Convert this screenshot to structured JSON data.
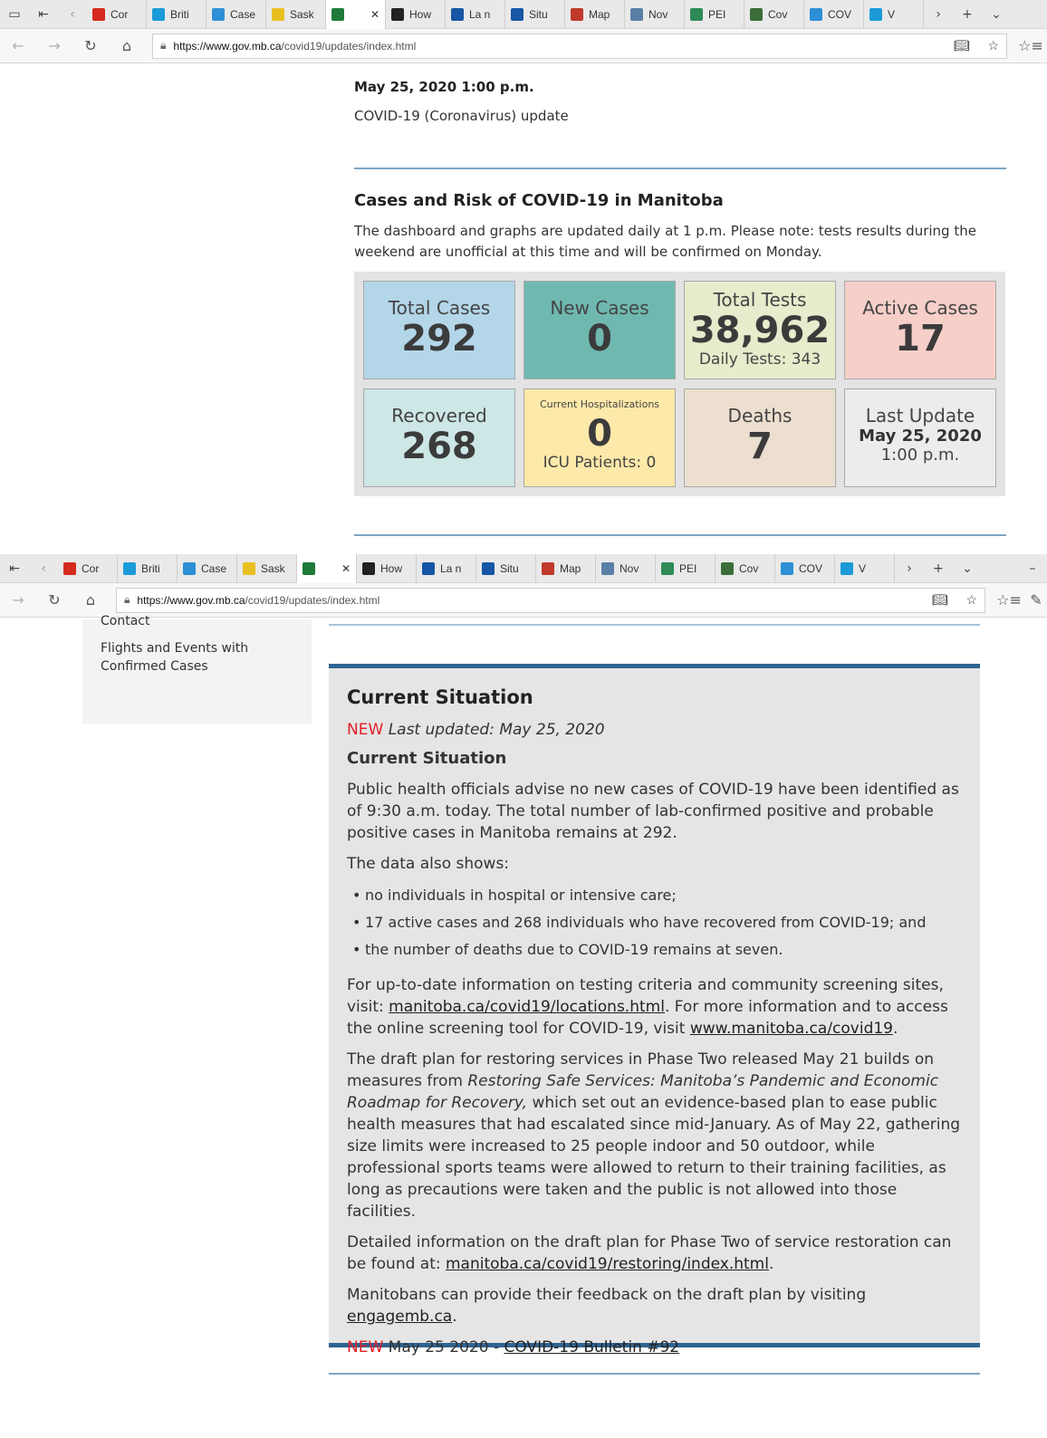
{
  "browser_top": {
    "tabs": [
      {
        "label": "Cor",
        "color": "#d52b1e"
      },
      {
        "label": "Briti",
        "color": "#1a9bd7"
      },
      {
        "label": "Case",
        "color": "#2d8fd6"
      },
      {
        "label": "Sask",
        "color": "#e8c020"
      },
      {
        "label": "",
        "color": "#1f7a3a",
        "active": true
      },
      {
        "label": "How",
        "color": "#222222"
      },
      {
        "label": "La n",
        "color": "#1656a4"
      },
      {
        "label": "Situ",
        "color": "#1656a4"
      },
      {
        "label": "Map",
        "color": "#c0392b"
      },
      {
        "label": "Nov",
        "color": "#5a7fa6"
      },
      {
        "label": "PEI",
        "color": "#2e8b57"
      },
      {
        "label": "Cov",
        "color": "#3b6e3a"
      },
      {
        "label": "COV",
        "color": "#2d8fd6"
      },
      {
        "label": "V",
        "color": "#1a9bd7"
      }
    ],
    "url_host": "https://www.gov.mb.ca",
    "url_path": "/covid19/updates/index.html"
  },
  "browser_bottom": {
    "tabs": [
      {
        "label": "Cor",
        "color": "#d52b1e"
      },
      {
        "label": "Briti",
        "color": "#1a9bd7"
      },
      {
        "label": "Case",
        "color": "#2d8fd6"
      },
      {
        "label": "Sask",
        "color": "#e8c020"
      },
      {
        "label": "",
        "color": "#1f7a3a",
        "active": true
      },
      {
        "label": "How",
        "color": "#222222"
      },
      {
        "label": "La n",
        "color": "#1656a4"
      },
      {
        "label": "Situ",
        "color": "#1656a4"
      },
      {
        "label": "Map",
        "color": "#c0392b"
      },
      {
        "label": "Nov",
        "color": "#5a7fa6"
      },
      {
        "label": "PEI",
        "color": "#2e8b57"
      },
      {
        "label": "Cov",
        "color": "#3b6e3a"
      },
      {
        "label": "COV",
        "color": "#2d8fd6"
      },
      {
        "label": "V",
        "color": "#1a9bd7"
      }
    ],
    "url_host": "https://www.gov.mb.ca",
    "url_path": "/covid19/updates/index.html"
  },
  "update": {
    "date": "May 25, 2020 1:00 p.m.",
    "subtitle": "COVID-19 (Coronavirus) update",
    "cases_heading": "Cases and Risk of COVID-19 in Manitoba",
    "cases_note": "The dashboard and graphs are updated daily at 1 p.m. Please note: tests results during the weekend are unofficial at this time and will be confirmed on Monday."
  },
  "dashboard": {
    "total_cases": {
      "label": "Total Cases",
      "value": "292",
      "color": "#b3d6e8"
    },
    "new_cases": {
      "label": "New Cases",
      "value": "0",
      "color": "#6fb8b0"
    },
    "total_tests": {
      "label": "Total Tests",
      "value": "38,962",
      "sub": "Daily Tests: 343",
      "color": "#e8ebcc"
    },
    "active_cases": {
      "label": "Active Cases",
      "value": "17",
      "color": "#f6cfc9"
    },
    "recovered": {
      "label": "Recovered",
      "value": "268",
      "color": "#cde6e6"
    },
    "hospitalizations": {
      "label": "Current Hospitalizations",
      "value": "0",
      "sub": "ICU Patients: 0",
      "color": "#fde9a9"
    },
    "deaths": {
      "label": "Deaths",
      "value": "7",
      "color": "#ecdfcf"
    },
    "last_update": {
      "label": "Last Update",
      "date": "May 25, 2020",
      "time": "1:00 p.m.",
      "color": "#ececec"
    }
  },
  "sidebar": {
    "cut_item": "Contact",
    "link": "Flights and Events with Confirmed Cases"
  },
  "situation": {
    "heading": "Current Situation",
    "new_tag": "NEW",
    "last_updated": "Last updated: May 25, 2020",
    "subheading": "Current Situation",
    "p1": "Public health officials advise no new cases of COVID-19 have been identified as of 9:30 a.m. today. The total number of lab-confirmed positive and probable positive cases in Manitoba remains at 292.",
    "p2": "The data also shows:",
    "bullets": [
      "no individuals in hospital or intensive care;",
      "17 active cases and 268 individuals who have recovered from COVID-19; and",
      "the number of deaths due to COVID-19 remains at seven."
    ],
    "p3_a": "For up-to-date information on testing criteria and community screening sites, visit: ",
    "p3_link1": "manitoba.ca/covid19/locations.html",
    "p3_b": ". For more information and to access the online screening tool for COVID-19, visit ",
    "p3_link2": "www.manitoba.ca/covid19",
    "p3_c": ".",
    "p4_a": "The draft plan for restoring services in Phase Two released May 21 builds on measures from ",
    "p4_italic": "Restoring Safe Services:  Manitoba’s Pandemic and Economic Roadmap for Recovery,",
    "p4_b": " which set out an evidence-based plan to ease public health measures that had escalated since mid-January. As of May 22, gathering size limits were increased to 25 people indoor and 50 outdoor, while professional sports teams were allowed to return to their training facilities, as long as precautions were taken and the public is not allowed into those facilities.",
    "p5_a": "Detailed information on the draft plan for Phase Two of service restoration can be found at: ",
    "p5_link": "manitoba.ca/covid19/restoring/index.html",
    "p5_b": ".",
    "p6_a": "Manitobans can provide their feedback on the draft plan by visiting ",
    "p6_link": "engagemb.ca",
    "p6_b": ".",
    "bulletin_prefix": " May 25 2020 - ",
    "bulletin_link": "COVID-19 Bulletin #92"
  }
}
